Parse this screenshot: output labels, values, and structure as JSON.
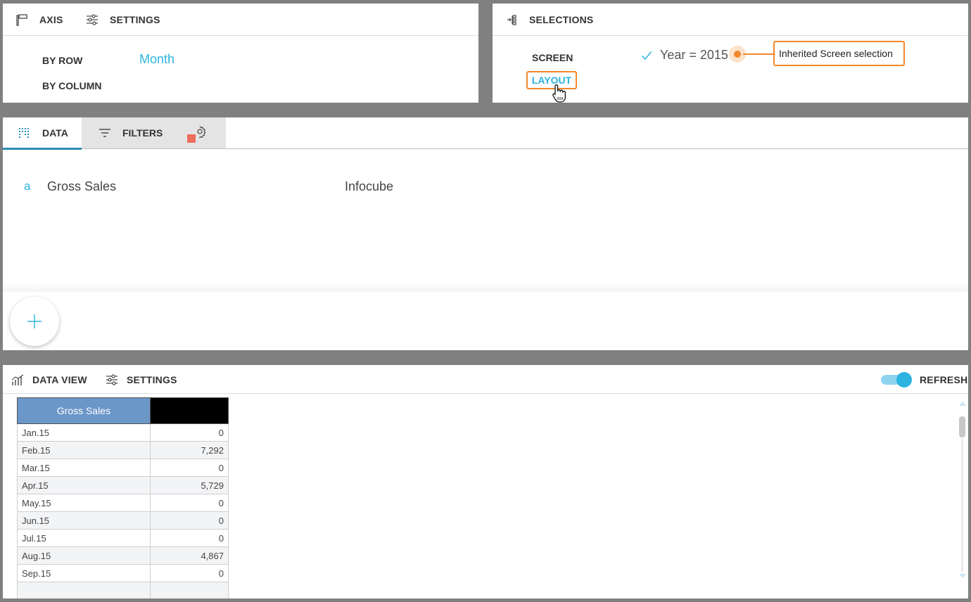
{
  "axis_panel": {
    "axis_label": "AXIS",
    "settings_label": "SETTINGS",
    "by_row_label": "BY ROW",
    "by_row_value": "Month",
    "by_column_label": "BY COLUMN"
  },
  "selections_panel": {
    "title": "SELECTIONS",
    "screen_label": "SCREEN",
    "layout_label": "LAYOUT",
    "selection_value": "Year = 2015",
    "tooltip": "Inherited Screen selection"
  },
  "data_panel": {
    "tabs": [
      {
        "label": "DATA"
      },
      {
        "label": "FILTERS"
      }
    ],
    "rows": [
      {
        "type": "a",
        "name": "Gross Sales",
        "source": "Infocube"
      }
    ]
  },
  "dataview_panel": {
    "title": "DATA VIEW",
    "settings_label": "SETTINGS",
    "refresh_label": "REFRESH",
    "table": {
      "headers": [
        "Gross Sales",
        ""
      ],
      "rows": [
        [
          "Jan.15",
          "0"
        ],
        [
          "Feb.15",
          "7,292"
        ],
        [
          "Mar.15",
          "0"
        ],
        [
          "Apr.15",
          "5,729"
        ],
        [
          "May.15",
          "0"
        ],
        [
          "Jun.15",
          "0"
        ],
        [
          "Jul.15",
          "0"
        ],
        [
          "Aug.15",
          "4,867"
        ],
        [
          "Sep.15",
          "0"
        ]
      ]
    }
  },
  "colors": {
    "accent": "#2cb3e0",
    "highlight": "#f0882b",
    "header_blue": "#6b96c8"
  }
}
